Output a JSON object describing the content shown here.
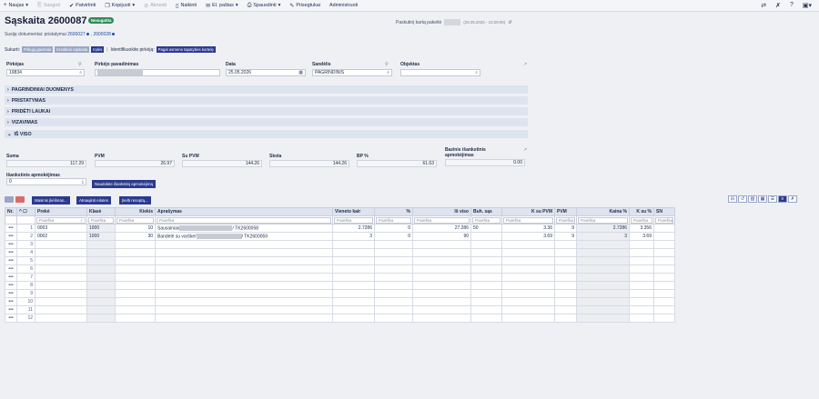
{
  "toolbar": {
    "items": [
      {
        "label": "Naujas",
        "icon": "plus-icon"
      },
      {
        "label": "Saugoti",
        "icon": "save-icon"
      },
      {
        "label": "Patvirtinti",
        "icon": "check-icon"
      },
      {
        "label": "Kopijuoti",
        "icon": "copy-icon"
      },
      {
        "label": "Atmesti",
        "icon": "reject-icon"
      },
      {
        "label": "Naikinti",
        "icon": "trash-icon"
      },
      {
        "label": "El. paštas",
        "icon": "mail-icon"
      },
      {
        "label": "Spausdinti",
        "icon": "print-icon"
      },
      {
        "label": "Prisegtukai",
        "icon": "paperclip-icon"
      },
      {
        "label": "Administruoti",
        "icon": ""
      }
    ]
  },
  "header": {
    "title": "Sąskaita 2600087",
    "badge": "Nesugatita",
    "last_modified_label": "Paskutinį kartą pakeitė",
    "last_modified_time": "(25.05.2026 - 10:29:09)",
    "related_label": "Susiję dokumentai: pristatymai",
    "related_links": [
      "2600027",
      "2600028"
    ]
  },
  "created": {
    "label": "Sukurti:",
    "chips": [
      "Pirkųjų gavimas",
      "Kreditinė sąskaita",
      "Irykis"
    ],
    "identify_label": "Identifikuokite pirkėją:",
    "identify_button": "Pagal asmens tapatybės kortelę"
  },
  "fields": {
    "pirkejas": {
      "label": "Pirkėjas",
      "value": "19834"
    },
    "pirkejo_pav": {
      "label": "Pirkėjo pavadinimas"
    },
    "data": {
      "label": "Data",
      "value": "25.05.2026"
    },
    "sandelis": {
      "label": "Sandėlis",
      "value": "PAGRINDINIS"
    },
    "objektas": {
      "label": "Objektas",
      "value": ""
    }
  },
  "sections": [
    "PAGRINDINIAI DUOMENYS",
    "PRISTATYMAS",
    "PRIDĖTI LAUKAI",
    "VIZAVIMAS",
    "IŠ VISO"
  ],
  "totals": {
    "suma": {
      "label": "Suma",
      "value": "117.29"
    },
    "pvm": {
      "label": "PVM",
      "value": "26.97"
    },
    "su_pvm": {
      "label": "Su PVM",
      "value": "144.26"
    },
    "skola": {
      "label": "Skola",
      "value": "144.26"
    },
    "bp": {
      "label": "BP %",
      "value": "61.63"
    },
    "bazinis_l1": "Bazinis išankstinis",
    "bazinis_l2": "apmokėjimas",
    "bazinis_value": "0.00",
    "isankstinis_label": "Išankstinis apmokėjimas",
    "isankstinis_value": "0",
    "use_button": "Naudokite išankstinį apmokėjimą"
  },
  "table_buttons": [
    "Masinis įkėlimas...",
    "Atnaujinti eilutes",
    "Įkelti receptą..."
  ],
  "table": {
    "headers": [
      "Nr.",
      "Prekė",
      "Klasė",
      "Kiekis",
      "Aprašymas",
      "Vieneto kair",
      "%",
      "Iš viso",
      "Buh. sąs",
      "K su PVM",
      "PVM",
      "Kaina %",
      "K su %",
      "SN"
    ],
    "search_placeholder": "Paieška",
    "rows": [
      {
        "nr": "1",
        "preke": "0003",
        "klase": "1000",
        "kiekis": "10",
        "apr": "Sausainiai/",
        "apr2": "/ TK2600058",
        "vnt": "2.7286",
        "pct": "0",
        "is": "27.286",
        "buh": "50",
        "ksu": "3.36",
        "pvm": "9",
        "kaina": "2.7286",
        "ksup": "3.356"
      },
      {
        "nr": "2",
        "preke": "0002",
        "klase": "1000",
        "kiekis": "30",
        "apr": "Bandelė su varške/",
        "apr2": "/ TK2600059",
        "vnt": "3",
        "pct": "0",
        "is": "90",
        "buh": "",
        "ksu": "3.69",
        "pvm": "9",
        "kaina": "3",
        "ksup": "3.69"
      }
    ],
    "empty_rows": [
      "3",
      "4",
      "5",
      "6",
      "7",
      "8",
      "9",
      "10",
      "11",
      "12"
    ]
  }
}
